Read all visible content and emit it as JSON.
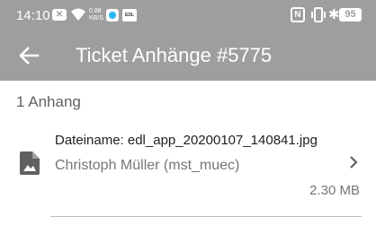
{
  "status_bar": {
    "time": "14:10",
    "speed_value": "0.88",
    "speed_unit": "KB/S",
    "app_badge": "EDL",
    "battery": "95",
    "nfc_label": "N",
    "x_box": "✕"
  },
  "app_bar": {
    "title": "Ticket Anhänge #5775",
    "back_icon": "arrow-left-icon"
  },
  "content": {
    "count_label": "1 Anhang",
    "attachments": [
      {
        "file_name": "Dateiname: edl_app_20200107_140841.jpg",
        "owner": "Christoph Müller (mst_muec)",
        "size": "2.30 MB",
        "icon": "image-file-icon"
      }
    ]
  },
  "colors": {
    "bar": "#9e9e9e",
    "text_primary": "#212121",
    "text_secondary": "#757575"
  }
}
